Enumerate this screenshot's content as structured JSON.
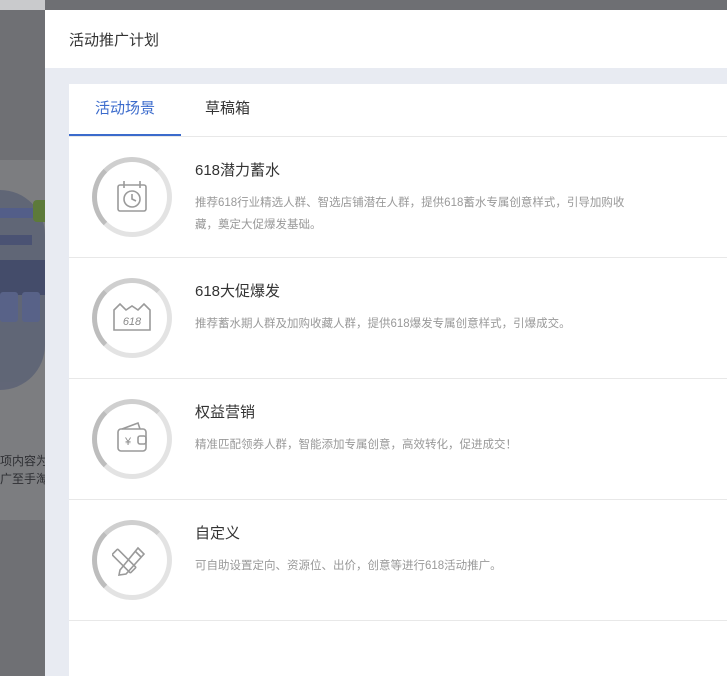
{
  "background": {
    "text_line1": "项内容为",
    "text_line2": "广至手淘"
  },
  "drawer": {
    "title": "活动推广计划",
    "tabs": [
      {
        "label": "活动场景",
        "active": true
      },
      {
        "label": "草稿箱",
        "active": false
      }
    ],
    "items": [
      {
        "title": "618潜力蓄水",
        "desc": "推荐618行业精选人群、智选店铺潜在人群，提供618蓄水专属创意样式，引导加购收藏，奠定大促爆发基础。",
        "icon": "alarm-clock-icon"
      },
      {
        "title": "618大促爆发",
        "desc": "推荐蓄水期人群及加购收藏人群，提供618爆发专属创意样式，引爆成交。",
        "icon": "618-badge-icon"
      },
      {
        "title": "权益营销",
        "desc": "精准匹配领券人群，智能添加专属创意，高效转化，促进成交！",
        "icon": "coupon-wallet-icon"
      },
      {
        "title": "自定义",
        "desc": "可自助设置定向、资源位、出价，创意等进行618活动推广。",
        "icon": "pencil-ruler-icon"
      }
    ]
  },
  "colors": {
    "accent": "#3b6bcc"
  }
}
